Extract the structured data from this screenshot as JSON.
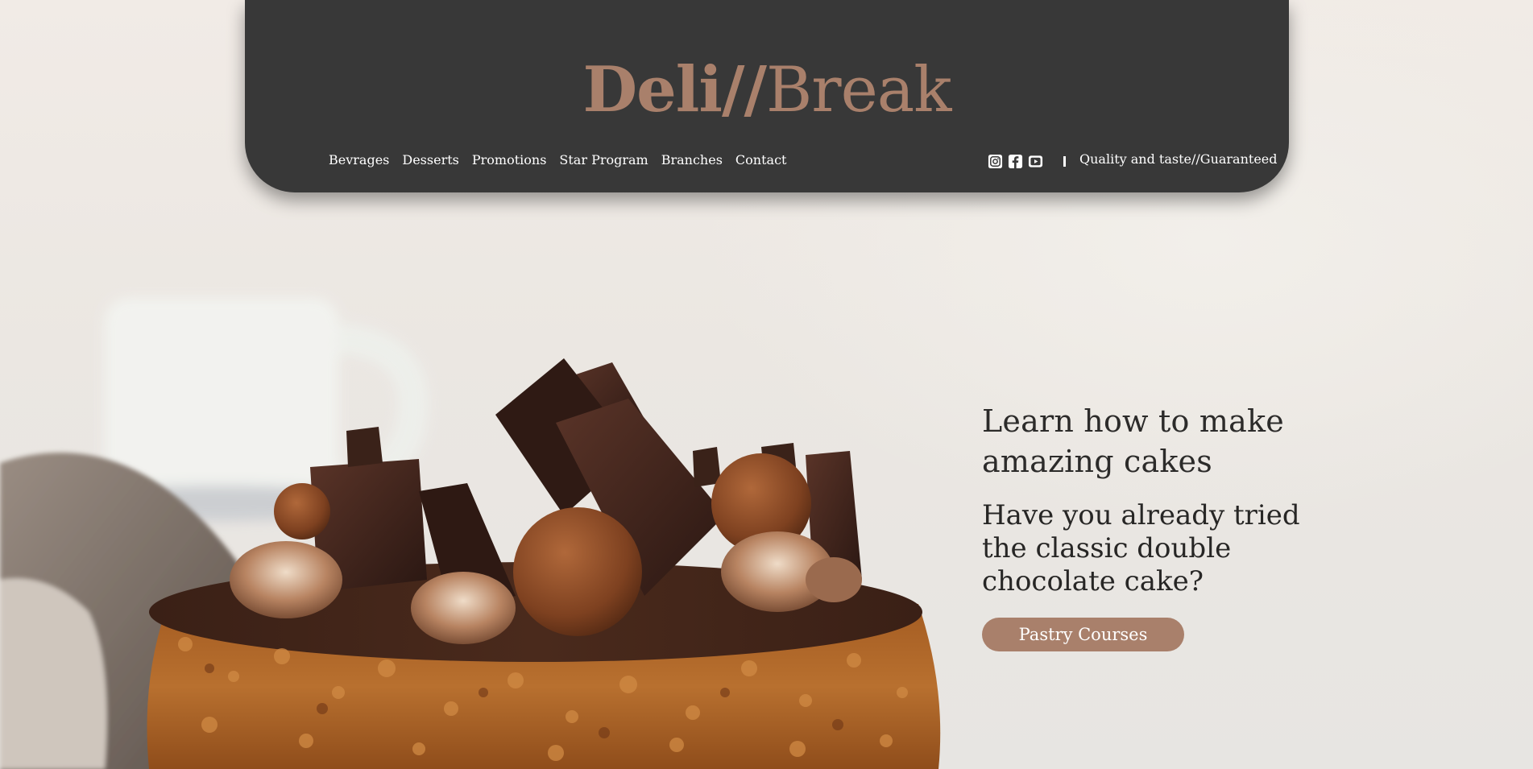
{
  "brand": {
    "name_bold": "Deli//",
    "name_light": "Break",
    "color": "#a9806b"
  },
  "header": {
    "background": "#383838",
    "nav": [
      {
        "label": "Bevrages"
      },
      {
        "label": "Desserts"
      },
      {
        "label": "Promotions"
      },
      {
        "label": "Star Program"
      },
      {
        "label": "Branches"
      },
      {
        "label": "Contact"
      }
    ],
    "socials": [
      "instagram-icon",
      "facebook-icon",
      "youtube-icon"
    ],
    "tagline": "Quality and taste//Guaranteed"
  },
  "hero": {
    "title": "Learn how to make amazing cakes",
    "subtitle": "Have you already tried the classic double chocolate cake?",
    "cta_label": "Pastry Courses",
    "image": "chocolate-cake-photo"
  }
}
